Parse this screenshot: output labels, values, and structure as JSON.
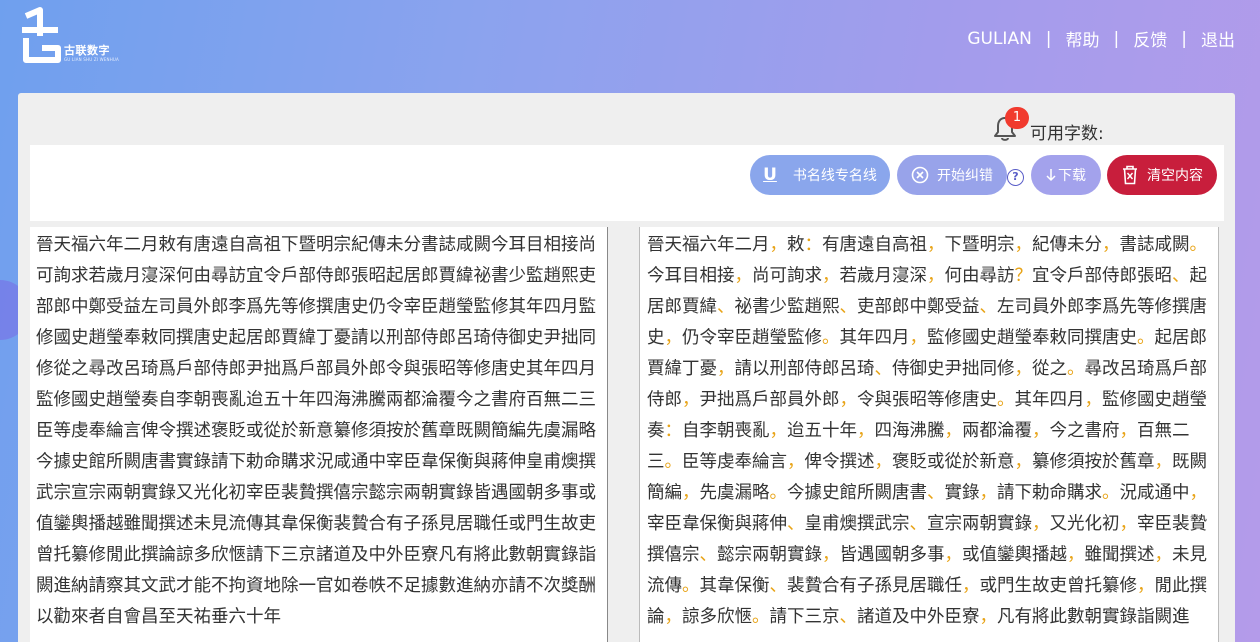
{
  "brand": {
    "logo_text": "古联数字",
    "logo_subtext": "GU LIAN SHU ZI WENHUA"
  },
  "nav": {
    "items": [
      "GULIAN",
      "帮助",
      "反馈",
      "退出"
    ],
    "separator": "|"
  },
  "notification": {
    "count": "1",
    "available_chars_label": "可用字数:"
  },
  "toolbar": {
    "underline_label": "书名线专名线",
    "underline_icon_glyph": "U",
    "start_label": "开始纠错",
    "download_label": "下载",
    "clear_label": "清空内容",
    "help_glyph": "?"
  },
  "colors": {
    "clear_button": "#c81e3c",
    "punctuation": "#e8a418",
    "badge": "#f13a2e"
  },
  "source_text": "晉天福六年二月敕有唐遠自高祖下暨明宗紀傳未分書誌咸闕今耳目相接尚可詢求若歲月寖深何由尋訪宜令戶部侍郎張昭起居郎賈緯祕書少監趙熙吏部郎中鄭受益左司員外郎李爲先等修撰唐史仍令宰臣趙瑩監修其年四月監修國史趙瑩奉敕同撰唐史起居郎賈緯丁憂請以刑部侍郎呂琦侍御史尹拙同修從之尋改呂琦爲戶部侍郎尹拙爲戶部員外郎令與張昭等修唐史其年四月監修國史趙瑩奏自李朝喪亂迨五十年四海沸騰兩都淪覆今之書府百無二三臣等虔奉綸言俾令撰述褒貶或從於新意纂修須按於舊章既闕簡編先虞漏略今據史館所闕唐書實錄請下勅命購求況咸通中宰臣韋保衡與蔣伸皇甫燠撰武宗宣宗兩朝實錄又光化初宰臣裴贄撰僖宗懿宗兩朝實錄皆遇國朝多事或值鑾輿播越雖聞撰述未見流傳其韋保衡裴贄合有子孫見居職任或門生故吏曾托纂修閒此撰論諒多欣愜請下三京諸道及中外臣寮凡有將此數朝實錄詣闕進納請察其文武才能不拘資地除一官如卷帙不足據數進納亦請不次獎酬以勸來者自會昌至天祐垂六十年",
  "corrected_segments": [
    "晉天福六年二月",
    "，",
    "敕",
    "：",
    "有唐遠自高祖",
    "，",
    "下暨明宗",
    "，",
    "紀傳未分",
    "，",
    "書誌咸闕",
    "。",
    "今耳目相接",
    "，",
    "尚可詢求",
    "，",
    "若歲月寖深",
    "，",
    "何由尋訪",
    "？",
    "宜令戶部侍郎張昭",
    "、",
    "起居郎賈緯",
    "、",
    "祕書少監趙熙",
    "、",
    "吏部郎中鄭受益",
    "、",
    "左司員外郎李爲先等修撰唐史",
    "，",
    "仍令宰臣趙瑩監修",
    "。",
    "其年四月",
    "，",
    "監修國史趙瑩奉敕同撰唐史",
    "。",
    "起居郎賈緯丁憂",
    "，",
    "請以刑部侍郎呂琦",
    "、",
    "侍御史尹拙同修",
    "，",
    "從之",
    "。",
    "尋改呂琦爲戶部侍郎",
    "，",
    "尹拙爲戶部員外郎",
    "，",
    "令與張昭等修唐史",
    "。",
    "其年四月",
    "，",
    "監修國史趙瑩奏",
    "：",
    "自李朝喪亂",
    "，",
    "迨五十年",
    "，",
    "四海沸騰",
    "，",
    "兩都淪覆",
    "，",
    "今之書府",
    "，",
    "百無二三",
    "。",
    "臣等虔奉綸言",
    "，",
    "俾令撰述",
    "，",
    "褒貶或從於新意",
    "，",
    "纂修須按於舊章",
    "，",
    "既闕簡編",
    "，",
    "先虞漏略",
    "。",
    "今據史館所闕唐書",
    "、",
    "實錄",
    "，",
    "請下勅命購求",
    "。",
    "況咸通中",
    "，",
    "宰臣韋保衡與蔣伸",
    "、",
    "皇甫燠撰武宗",
    "、",
    "宣宗兩朝實錄",
    "，",
    "又光化初",
    "，",
    "宰臣裴贄撰僖宗",
    "、",
    "懿宗兩朝實錄",
    "，",
    "皆遇國朝多事",
    "，",
    "或值鑾輿播越",
    "，",
    "雖聞撰述",
    "，",
    "未見流傳",
    "。",
    "其韋保衡",
    "、",
    "裴贄合有子孫見居職任",
    "，",
    "或門生故吏曾托纂修",
    "，",
    "閒此撰論",
    "，",
    "諒多欣愜",
    "。",
    "請下三京",
    "、",
    "諸道及中外臣寮",
    "，",
    "凡有將此數朝實錄詣闕進"
  ]
}
